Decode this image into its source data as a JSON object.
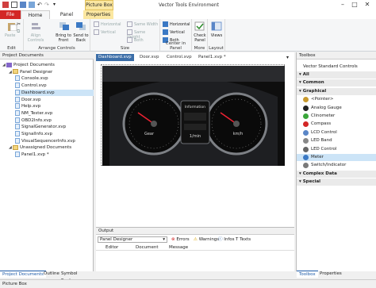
{
  "window": {
    "title": "Vector Tools Environment",
    "contextual_tab": "Picture Box"
  },
  "ribbon_tabs": [
    "File",
    "Home",
    "Panel",
    "Properties"
  ],
  "ribbon": {
    "edit": {
      "paste": "Paste",
      "label": "Edit"
    },
    "arrange": {
      "align": "Align Controls",
      "bring_front": "Bring to Front",
      "send_back": "Send to Back",
      "label": "Arrange Controls"
    },
    "size": {
      "horizontal": "Horizontal",
      "vertical": "Vertical",
      "same_width": "Same Width",
      "same_height": "Same Height",
      "both": "Both",
      "label": "Size"
    },
    "center": {
      "horizontal": "Horizontal",
      "vertical": "Vertical",
      "both": "Both",
      "label": "Center in Panel"
    },
    "more": {
      "check": "Check Panel",
      "label": "More"
    },
    "layout": {
      "views": "Views",
      "label": "Layout"
    }
  },
  "project_pane": {
    "title": "Project Documents",
    "tree": [
      {
        "label": "Project Documents",
        "kind": "solution",
        "level": 0
      },
      {
        "label": "Panel Designer",
        "kind": "folder",
        "level": 1
      },
      {
        "label": "Console.xvp",
        "kind": "file",
        "level": 2
      },
      {
        "label": "Control.xvp",
        "kind": "file",
        "level": 2
      },
      {
        "label": "Dashboard.xvp",
        "kind": "file",
        "level": 2,
        "selected": true
      },
      {
        "label": "Door.xvp",
        "kind": "file",
        "level": 2
      },
      {
        "label": "Help.xvp",
        "kind": "file",
        "level": 2
      },
      {
        "label": "NM_Tester.xvp",
        "kind": "file",
        "level": 2
      },
      {
        "label": "OBD2Info.xvp",
        "kind": "file",
        "level": 2
      },
      {
        "label": "SignalGenerator.xvp",
        "kind": "file",
        "level": 2
      },
      {
        "label": "SignalInfo.xvp",
        "kind": "file",
        "level": 2
      },
      {
        "label": "VisualSequencerInfo.xvp",
        "kind": "file",
        "level": 2
      },
      {
        "label": "Unassigned Documents",
        "kind": "folder",
        "level": 1
      },
      {
        "label": "Panel1.xvp *",
        "kind": "file",
        "level": 2
      }
    ],
    "bottom_tabs": [
      "Project Documents",
      "Outline",
      "Symbol Explorer"
    ]
  },
  "doc_tabs": [
    "Dashboard.xvp",
    "Door.xvp",
    "Control.xvp",
    "Panel1.xvp *"
  ],
  "dashboard": {
    "info_title": "Information",
    "info_value": "1/min",
    "gear_label": "Gear",
    "speed_label": "km/h"
  },
  "output": {
    "title": "Output",
    "source": "Panel Designer",
    "filters": {
      "errors": "Errors",
      "warnings": "Warnings",
      "infos": "Infos",
      "texts": "Texts"
    },
    "columns": [
      "Editor",
      "Document",
      "Message"
    ]
  },
  "toolbox": {
    "title": "Toolbox",
    "header": "Vector Standard Controls",
    "rows": [
      {
        "label": "All",
        "kind": "cat"
      },
      {
        "label": "Common",
        "kind": "cat"
      },
      {
        "label": "Graphical",
        "kind": "cat"
      },
      {
        "label": "<Pointer>",
        "kind": "item",
        "icon": "pointer-icon"
      },
      {
        "label": "Analog Gauge",
        "kind": "item",
        "icon": "gauge-icon"
      },
      {
        "label": "Clinometer",
        "kind": "item",
        "icon": "clinometer-icon"
      },
      {
        "label": "Compass",
        "kind": "item",
        "icon": "compass-icon"
      },
      {
        "label": "LCD Control",
        "kind": "item",
        "icon": "lcd-icon"
      },
      {
        "label": "LED Band",
        "kind": "item",
        "icon": "led-band-icon"
      },
      {
        "label": "LED Control",
        "kind": "item",
        "icon": "led-icon"
      },
      {
        "label": "Meter",
        "kind": "item",
        "icon": "meter-icon",
        "selected": true
      },
      {
        "label": "Switch/Indicator",
        "kind": "item",
        "icon": "switch-icon"
      },
      {
        "label": "Complex Data",
        "kind": "cat"
      },
      {
        "label": "Special",
        "kind": "cat"
      }
    ],
    "bottom_tabs": [
      "Toolbox",
      "Properties"
    ]
  },
  "status": {
    "text": "Picture Box"
  },
  "colors": {
    "file_tab": "#d32626",
    "context": "#fbe7a1",
    "active_doc_tab": "#3c6ea8",
    "selection": "#cce4f7"
  }
}
